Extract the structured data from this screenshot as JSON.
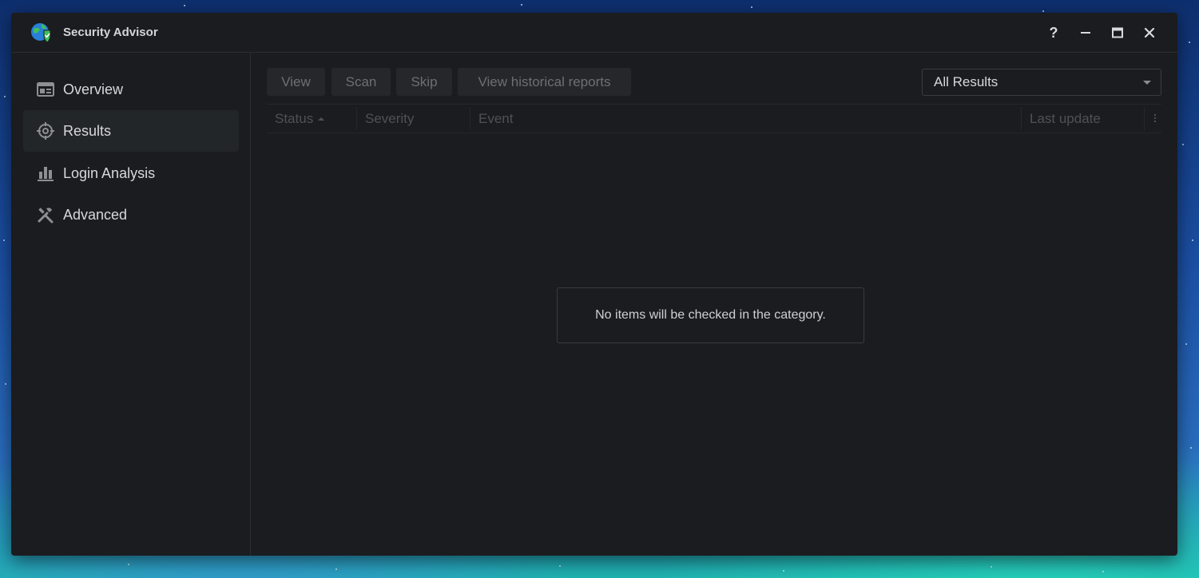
{
  "window": {
    "title": "Security Advisor",
    "controls": {
      "help": "?",
      "minimize_icon": "minimize-icon",
      "maximize_icon": "maximize-icon",
      "close_icon": "close-icon"
    }
  },
  "sidebar": {
    "items": [
      {
        "label": "Overview",
        "icon": "overview-icon",
        "active": false
      },
      {
        "label": "Results",
        "icon": "target-icon",
        "active": true
      },
      {
        "label": "Login Analysis",
        "icon": "bar-chart-icon",
        "active": false
      },
      {
        "label": "Advanced",
        "icon": "tools-icon",
        "active": false
      }
    ]
  },
  "toolbar": {
    "buttons": [
      {
        "label": "View",
        "enabled": false
      },
      {
        "label": "Scan",
        "enabled": false
      },
      {
        "label": "Skip",
        "enabled": false
      },
      {
        "label": "View historical reports",
        "enabled": false
      }
    ],
    "filter": {
      "selected": "All Results"
    }
  },
  "grid": {
    "columns": [
      "Status",
      "Severity",
      "Event",
      "Last update"
    ],
    "sorted_column": "Status",
    "sort_direction": "ascending",
    "rows": [],
    "empty_message": "No items will be checked in the category."
  },
  "colors": {
    "window_bg": "#1b1c1f",
    "active_nav_bg": "#232629",
    "accent_green": "#3ec15a",
    "globe_blue": "#2a7fd6"
  }
}
